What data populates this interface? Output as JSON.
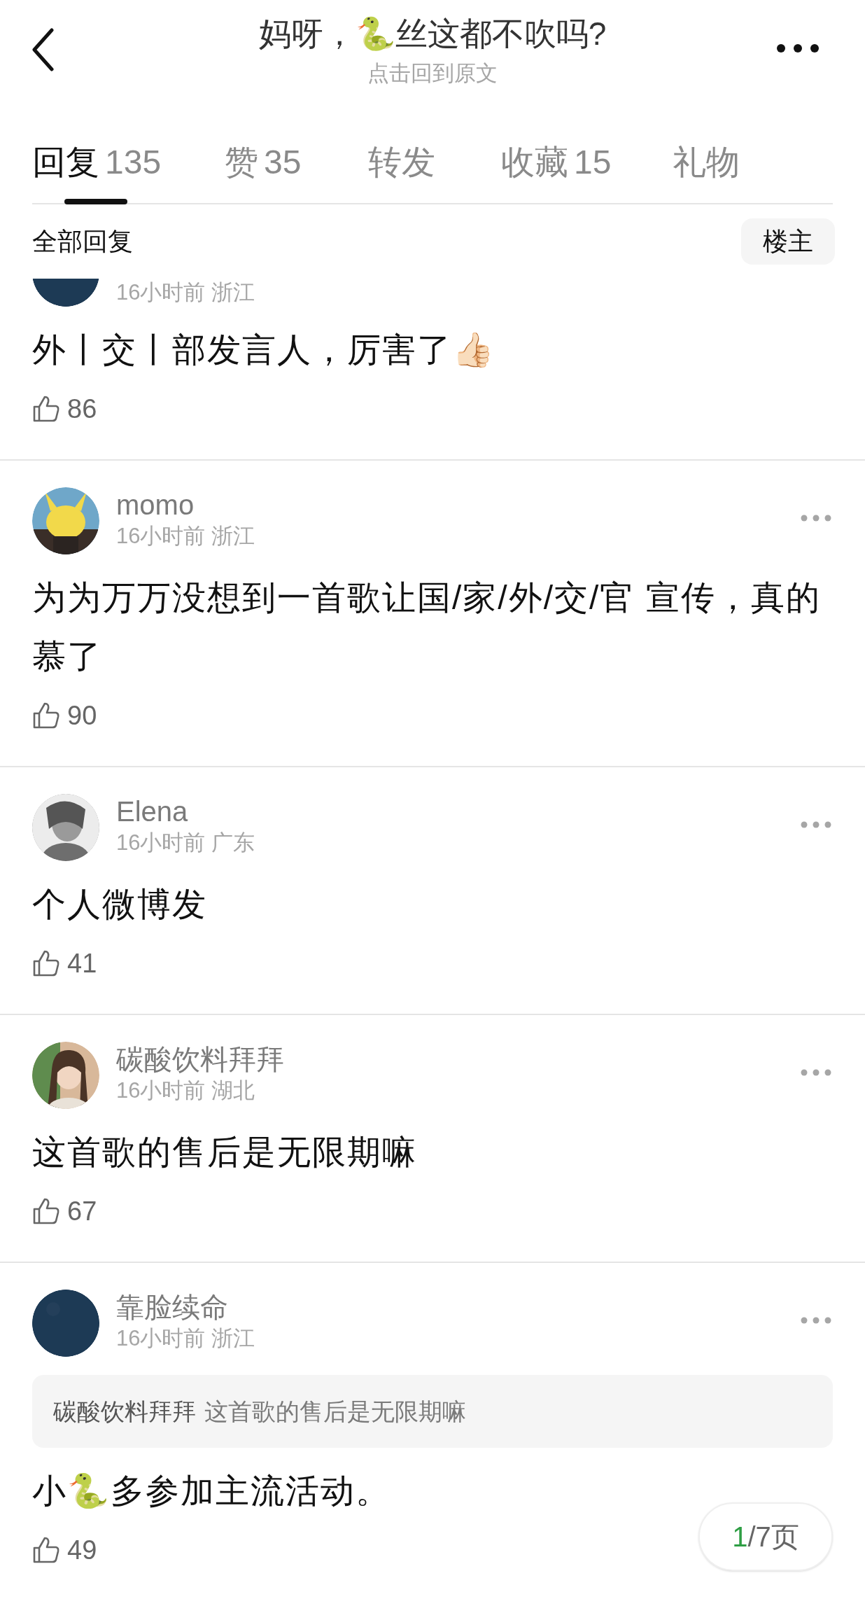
{
  "header": {
    "title": "妈呀，🐍丝这都不吹吗?",
    "subtitle": "点击回到原文"
  },
  "tabs": [
    {
      "label": "回复",
      "count": "135",
      "selected": true
    },
    {
      "label": "赞",
      "count": "35",
      "selected": false
    },
    {
      "label": "转发",
      "selected": false
    },
    {
      "label": "收藏",
      "count": "15",
      "selected": false
    },
    {
      "label": "礼物",
      "selected": false
    }
  ],
  "filter": {
    "label": "全部回复",
    "button": "楼主"
  },
  "comments": [
    {
      "time": "16小时前",
      "location": "浙江",
      "text": "外丨交丨部发言人，厉害了👍🏻",
      "likes": "86"
    },
    {
      "author": "momo",
      "time": "16小时前",
      "location": "浙江",
      "text": "为为万万没想到一首歌让国/家/外/交/官 宣传，真的慕了",
      "likes": "90"
    },
    {
      "author": "Elena",
      "time": "16小时前",
      "location": "广东",
      "text": "个人微博发",
      "likes": "41"
    },
    {
      "author": "碳酸饮料拜拜",
      "time": "16小时前",
      "location": "湖北",
      "text": "这首歌的售后是无限期嘛",
      "likes": "67"
    },
    {
      "author": "靠脸续命",
      "time": "16小时前",
      "location": "浙江",
      "quote": {
        "author": "碳酸饮料拜拜",
        "text": "这首歌的售后是无限期嘛"
      },
      "text": "小🐍多参加主流活动。",
      "likes": "49"
    }
  ],
  "pager": {
    "current": "1",
    "total": "/7页"
  }
}
